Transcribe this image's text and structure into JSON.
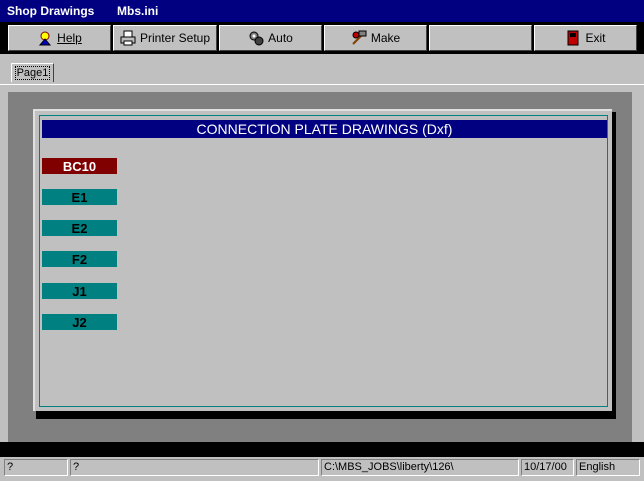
{
  "window": {
    "app_title": "Shop Drawings",
    "file_title": "Mbs.ini"
  },
  "toolbar": {
    "help": "Help",
    "printer_setup": "Printer Setup",
    "auto": "Auto",
    "make": "Make",
    "exit": "Exit"
  },
  "tabs": [
    {
      "label": "Page1"
    }
  ],
  "panel": {
    "title": "CONNECTION PLATE DRAWINGS (Dxf)",
    "items": [
      {
        "label": "BC10",
        "selected": true
      },
      {
        "label": "E1",
        "selected": false
      },
      {
        "label": "E2",
        "selected": false
      },
      {
        "label": "F2",
        "selected": false
      },
      {
        "label": "J1",
        "selected": false
      },
      {
        "label": "J2",
        "selected": false
      }
    ]
  },
  "status": {
    "field1": "?",
    "field2": "?",
    "path": "C:\\MBS_JOBS\\liberty\\126\\",
    "date": "10/17/00",
    "language": "English"
  },
  "colors": {
    "titlebar": "#000080",
    "selected_item": "#800000",
    "item": "#008080"
  }
}
